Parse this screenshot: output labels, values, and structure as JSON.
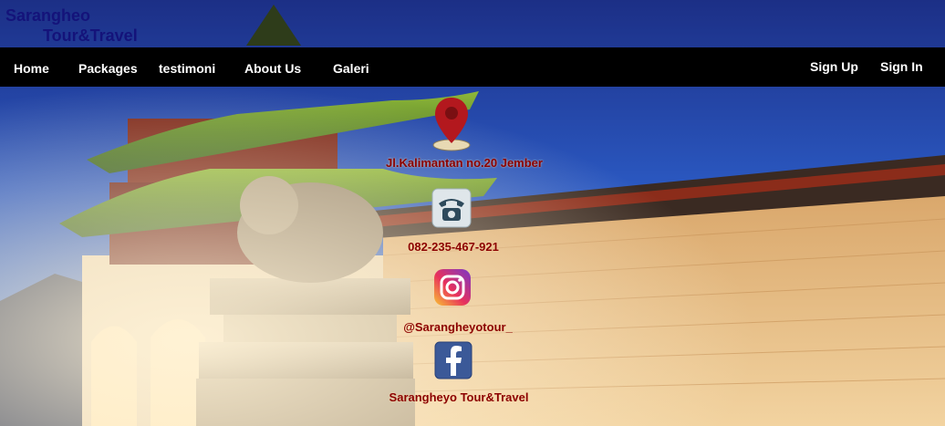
{
  "brand": {
    "line1": "Sarangheo",
    "line2": "Tour&Travel"
  },
  "nav": {
    "home": "Home",
    "packages": "Packages",
    "testimoni": "testimoni",
    "about": "About Us",
    "galeri": "Galeri",
    "signup": "Sign Up",
    "signin": "Sign In"
  },
  "contact": {
    "address": "Jl.Kalimantan no.20 Jember",
    "phone": "082-235-467-921",
    "instagram": "@Sarangheyotour_",
    "facebook": "Sarangheyo Tour&Travel"
  },
  "icons": {
    "location": "map-pin-icon",
    "phone": "telephone-icon",
    "instagram": "instagram-icon",
    "facebook": "facebook-icon"
  },
  "colors": {
    "brand": "#14137a",
    "navbar": "#000000",
    "contact_text": "#8b0000",
    "facebook_blue": "#3b5998"
  }
}
